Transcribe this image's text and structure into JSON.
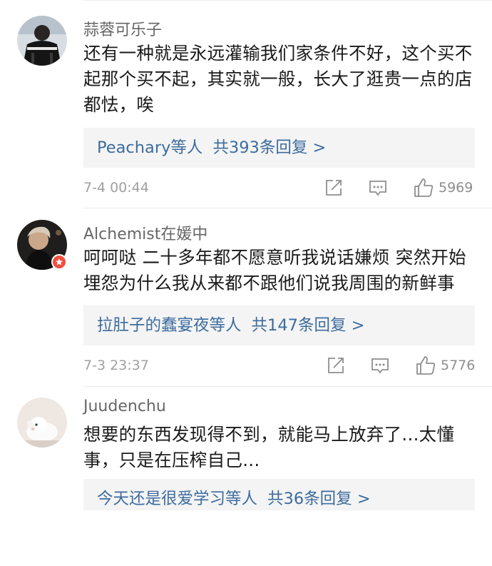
{
  "comments": [
    {
      "username": "蒜蓉可乐子",
      "text": "还有一种就是永远灌输我们家条件不好，这个买不起那个买不起，其实就一般，长大了逛贵一点的店都怯，唉",
      "reply_users": "Peachary",
      "reply_suffix": "等人",
      "reply_count": "共393条回复 >",
      "time": "7-4 00:44",
      "likes": "5969",
      "avatar_icon": "dark-jacket-avatar",
      "has_badge": false
    },
    {
      "username": "Alchemist在媛中",
      "text": "呵呵哒  二十多年都不愿意听我说话嫌烦 突然开始埋怨为什么我从来都不跟他们说我周围的新鲜事",
      "reply_users": "拉肚子的蠢宴夜",
      "reply_suffix": "等人",
      "reply_count": "共147条回复 >",
      "time": "7-3 23:37",
      "likes": "5776",
      "avatar_icon": "concert-portrait-avatar",
      "has_badge": true
    },
    {
      "username": "Juudenchu",
      "text": "想要的东西发现得不到，就能马上放弃了...太懂事，只是在压榨自己...",
      "reply_users": "今天还是很爱学习",
      "reply_suffix": "等人",
      "reply_count": "共36条回复 >",
      "avatar_icon": "white-rabbit-avatar",
      "has_badge": false
    }
  ],
  "icons": {
    "share": "share-icon",
    "comment": "comment-icon",
    "like": "thumbs-up-icon",
    "badge": "verified-star-icon"
  },
  "colors": {
    "link": "#3d6c9e",
    "username": "#666666",
    "meta": "#a0a0a0",
    "reply_bg": "#f4f4f4",
    "badge": "#f04e3e"
  }
}
